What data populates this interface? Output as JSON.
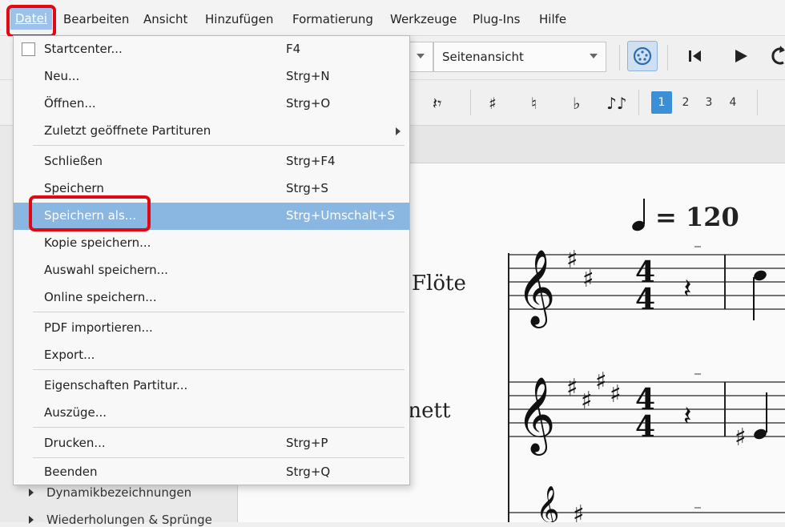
{
  "menubar": {
    "items": [
      {
        "label": "Datei"
      },
      {
        "label": "Bearbeiten"
      },
      {
        "label": "Ansicht"
      },
      {
        "label": "Hinzufügen"
      },
      {
        "label": "Formatierung"
      },
      {
        "label": "Werkzeuge"
      },
      {
        "label": "Plug-Ins"
      },
      {
        "label": "Hilfe"
      }
    ]
  },
  "toolbar": {
    "view_mode": "Seitenansicht",
    "voices": [
      "1",
      "2",
      "3",
      "4"
    ]
  },
  "file_menu": {
    "items": [
      {
        "label": "Startcenter...",
        "shortcut": "F4"
      },
      {
        "label": "Neu...",
        "shortcut": "Strg+N"
      },
      {
        "label": "Öffnen...",
        "shortcut": "Strg+O"
      },
      {
        "label": "Zuletzt geöffnete Partituren",
        "shortcut": ""
      },
      {
        "label": "Schließen",
        "shortcut": "Strg+F4"
      },
      {
        "label": "Speichern",
        "shortcut": "Strg+S"
      },
      {
        "label": "Speichern als...",
        "shortcut": "Strg+Umschalt+S"
      },
      {
        "label": "Kopie speichern...",
        "shortcut": ""
      },
      {
        "label": "Auswahl speichern...",
        "shortcut": ""
      },
      {
        "label": "Online speichern...",
        "shortcut": ""
      },
      {
        "label": "PDF importieren...",
        "shortcut": ""
      },
      {
        "label": "Export...",
        "shortcut": ""
      },
      {
        "label": "Eigenschaften Partitur...",
        "shortcut": ""
      },
      {
        "label": "Auszüge...",
        "shortcut": ""
      },
      {
        "label": "Drucken...",
        "shortcut": "Strg+P"
      },
      {
        "label": "Beenden",
        "shortcut": "Strg+Q"
      }
    ]
  },
  "palette": {
    "items": [
      "Dynamikbezeichnungen",
      "Wiederholungen & Sprünge"
    ]
  },
  "score": {
    "tempo": "= 120",
    "instruments": [
      "Flöte",
      "rnett"
    ]
  },
  "colors": {
    "highlight": "#8ab6e2",
    "annotation_red": "#e10a14",
    "voice_active": "#3a8fd6"
  }
}
